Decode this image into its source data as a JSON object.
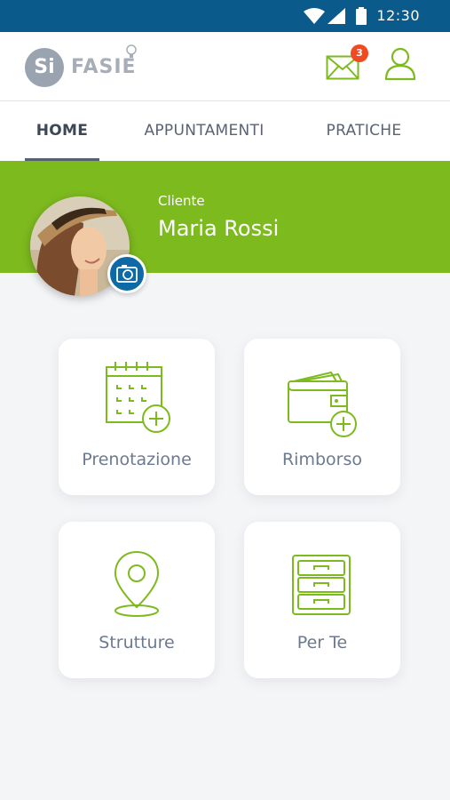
{
  "status_bar": {
    "time": "12:30"
  },
  "header": {
    "logo_circle": "Si",
    "logo_word": "FASIE",
    "mail_badge": "3",
    "accent": "#7dba1e"
  },
  "tabs": [
    {
      "label": "HOME",
      "active": true
    },
    {
      "label": "APPUNTAMENTI",
      "active": false
    },
    {
      "label": "PRATICHE",
      "active": false
    }
  ],
  "profile": {
    "role": "Cliente",
    "name": "Maria Rossi"
  },
  "menu": [
    {
      "label": "Prenotazione",
      "icon": "calendar-add-icon"
    },
    {
      "label": "Rimborso",
      "icon": "wallet-add-icon"
    },
    {
      "label": "Strutture",
      "icon": "map-pin-icon"
    },
    {
      "label": "Per Te",
      "icon": "drawers-icon"
    }
  ]
}
